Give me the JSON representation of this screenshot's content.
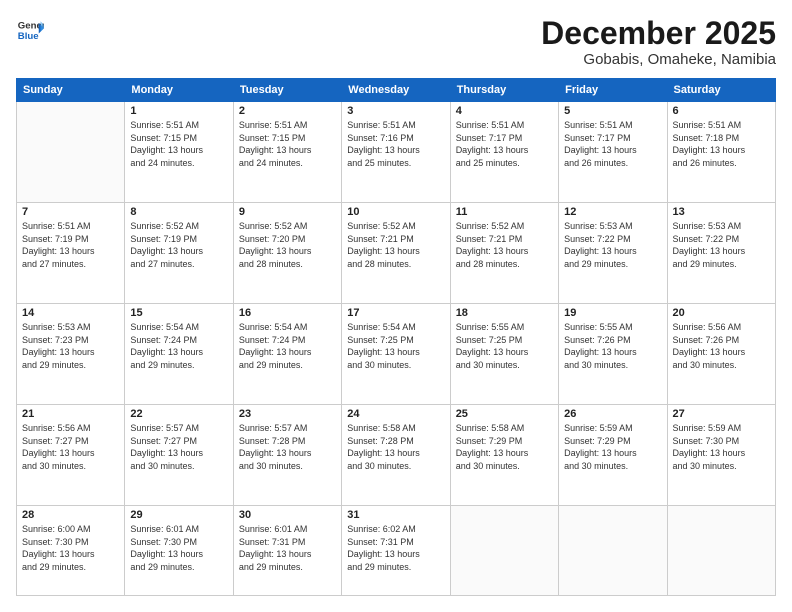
{
  "header": {
    "logo_line1": "General",
    "logo_line2": "Blue",
    "month": "December 2025",
    "location": "Gobabis, Omaheke, Namibia"
  },
  "days_of_week": [
    "Sunday",
    "Monday",
    "Tuesday",
    "Wednesday",
    "Thursday",
    "Friday",
    "Saturday"
  ],
  "weeks": [
    [
      {
        "day": "",
        "text": ""
      },
      {
        "day": "1",
        "text": "Sunrise: 5:51 AM\nSunset: 7:15 PM\nDaylight: 13 hours\nand 24 minutes."
      },
      {
        "day": "2",
        "text": "Sunrise: 5:51 AM\nSunset: 7:15 PM\nDaylight: 13 hours\nand 24 minutes."
      },
      {
        "day": "3",
        "text": "Sunrise: 5:51 AM\nSunset: 7:16 PM\nDaylight: 13 hours\nand 25 minutes."
      },
      {
        "day": "4",
        "text": "Sunrise: 5:51 AM\nSunset: 7:17 PM\nDaylight: 13 hours\nand 25 minutes."
      },
      {
        "day": "5",
        "text": "Sunrise: 5:51 AM\nSunset: 7:17 PM\nDaylight: 13 hours\nand 26 minutes."
      },
      {
        "day": "6",
        "text": "Sunrise: 5:51 AM\nSunset: 7:18 PM\nDaylight: 13 hours\nand 26 minutes."
      }
    ],
    [
      {
        "day": "7",
        "text": "Sunrise: 5:51 AM\nSunset: 7:19 PM\nDaylight: 13 hours\nand 27 minutes."
      },
      {
        "day": "8",
        "text": "Sunrise: 5:52 AM\nSunset: 7:19 PM\nDaylight: 13 hours\nand 27 minutes."
      },
      {
        "day": "9",
        "text": "Sunrise: 5:52 AM\nSunset: 7:20 PM\nDaylight: 13 hours\nand 28 minutes."
      },
      {
        "day": "10",
        "text": "Sunrise: 5:52 AM\nSunset: 7:21 PM\nDaylight: 13 hours\nand 28 minutes."
      },
      {
        "day": "11",
        "text": "Sunrise: 5:52 AM\nSunset: 7:21 PM\nDaylight: 13 hours\nand 28 minutes."
      },
      {
        "day": "12",
        "text": "Sunrise: 5:53 AM\nSunset: 7:22 PM\nDaylight: 13 hours\nand 29 minutes."
      },
      {
        "day": "13",
        "text": "Sunrise: 5:53 AM\nSunset: 7:22 PM\nDaylight: 13 hours\nand 29 minutes."
      }
    ],
    [
      {
        "day": "14",
        "text": "Sunrise: 5:53 AM\nSunset: 7:23 PM\nDaylight: 13 hours\nand 29 minutes."
      },
      {
        "day": "15",
        "text": "Sunrise: 5:54 AM\nSunset: 7:24 PM\nDaylight: 13 hours\nand 29 minutes."
      },
      {
        "day": "16",
        "text": "Sunrise: 5:54 AM\nSunset: 7:24 PM\nDaylight: 13 hours\nand 29 minutes."
      },
      {
        "day": "17",
        "text": "Sunrise: 5:54 AM\nSunset: 7:25 PM\nDaylight: 13 hours\nand 30 minutes."
      },
      {
        "day": "18",
        "text": "Sunrise: 5:55 AM\nSunset: 7:25 PM\nDaylight: 13 hours\nand 30 minutes."
      },
      {
        "day": "19",
        "text": "Sunrise: 5:55 AM\nSunset: 7:26 PM\nDaylight: 13 hours\nand 30 minutes."
      },
      {
        "day": "20",
        "text": "Sunrise: 5:56 AM\nSunset: 7:26 PM\nDaylight: 13 hours\nand 30 minutes."
      }
    ],
    [
      {
        "day": "21",
        "text": "Sunrise: 5:56 AM\nSunset: 7:27 PM\nDaylight: 13 hours\nand 30 minutes."
      },
      {
        "day": "22",
        "text": "Sunrise: 5:57 AM\nSunset: 7:27 PM\nDaylight: 13 hours\nand 30 minutes."
      },
      {
        "day": "23",
        "text": "Sunrise: 5:57 AM\nSunset: 7:28 PM\nDaylight: 13 hours\nand 30 minutes."
      },
      {
        "day": "24",
        "text": "Sunrise: 5:58 AM\nSunset: 7:28 PM\nDaylight: 13 hours\nand 30 minutes."
      },
      {
        "day": "25",
        "text": "Sunrise: 5:58 AM\nSunset: 7:29 PM\nDaylight: 13 hours\nand 30 minutes."
      },
      {
        "day": "26",
        "text": "Sunrise: 5:59 AM\nSunset: 7:29 PM\nDaylight: 13 hours\nand 30 minutes."
      },
      {
        "day": "27",
        "text": "Sunrise: 5:59 AM\nSunset: 7:30 PM\nDaylight: 13 hours\nand 30 minutes."
      }
    ],
    [
      {
        "day": "28",
        "text": "Sunrise: 6:00 AM\nSunset: 7:30 PM\nDaylight: 13 hours\nand 29 minutes."
      },
      {
        "day": "29",
        "text": "Sunrise: 6:01 AM\nSunset: 7:30 PM\nDaylight: 13 hours\nand 29 minutes."
      },
      {
        "day": "30",
        "text": "Sunrise: 6:01 AM\nSunset: 7:31 PM\nDaylight: 13 hours\nand 29 minutes."
      },
      {
        "day": "31",
        "text": "Sunrise: 6:02 AM\nSunset: 7:31 PM\nDaylight: 13 hours\nand 29 minutes."
      },
      {
        "day": "",
        "text": ""
      },
      {
        "day": "",
        "text": ""
      },
      {
        "day": "",
        "text": ""
      }
    ]
  ]
}
